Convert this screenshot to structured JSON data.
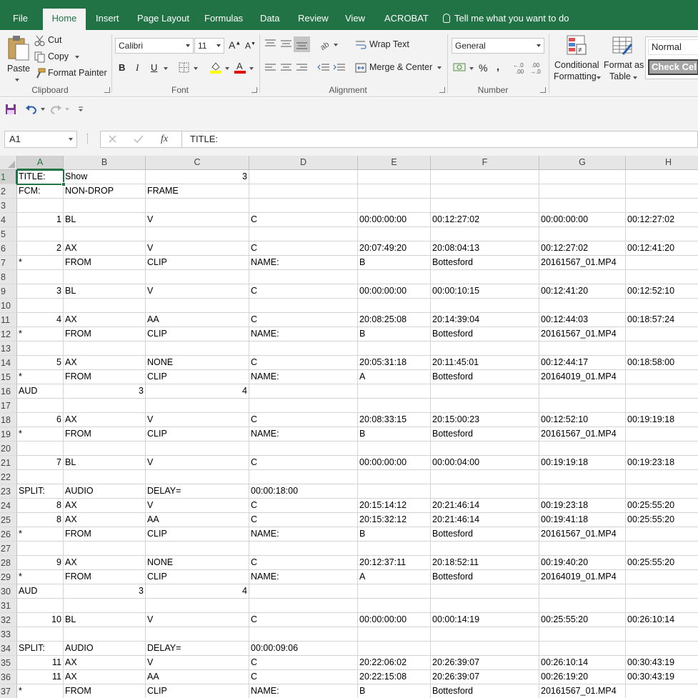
{
  "tabs": [
    "File",
    "Home",
    "Insert",
    "Page Layout",
    "Formulas",
    "Data",
    "Review",
    "View",
    "ACROBAT"
  ],
  "active_tab": "Home",
  "tell_me": "Tell me what you want to do",
  "clipboard": {
    "paste": "Paste",
    "cut": "Cut",
    "copy": "Copy",
    "format_painter": "Format Painter",
    "label": "Clipboard"
  },
  "font": {
    "name": "Calibri",
    "size": "11",
    "bold": "B",
    "italic": "I",
    "underline": "U",
    "label": "Font"
  },
  "alignment": {
    "wrap_text": "Wrap Text",
    "merge_center": "Merge & Center",
    "label": "Alignment"
  },
  "number": {
    "format": "General",
    "percent": "%",
    "comma": ",",
    "label": "Number"
  },
  "styles": {
    "conditional_formatting_1": "Conditional",
    "conditional_formatting_2": "Formatting",
    "format_as_table_1": "Format as",
    "format_as_table_2": "Table",
    "normal": "Normal",
    "check_cell": "Check Cell"
  },
  "formula_bar": {
    "name_box": "A1",
    "fx": "fx",
    "content": "TITLE:"
  },
  "columns": [
    "A",
    "B",
    "C",
    "D",
    "E",
    "F",
    "G",
    "H"
  ],
  "selected_column": "A",
  "selected_row": "1",
  "rows": [
    {
      "n": "1",
      "cells": [
        "TITLE:",
        "Show",
        "3",
        "",
        "",
        "",
        "",
        ""
      ]
    },
    {
      "n": "2",
      "cells": [
        "FCM:",
        "NON-DROP",
        "FRAME",
        "",
        "",
        "",
        "",
        ""
      ]
    },
    {
      "n": "3",
      "cells": [
        "",
        "",
        "",
        "",
        "",
        "",
        "",
        ""
      ]
    },
    {
      "n": "4",
      "cells": [
        "1",
        "BL",
        "V",
        "C",
        "00:00:00:00",
        "00:12:27:02",
        "00:00:00:00",
        "00:12:27:02"
      ]
    },
    {
      "n": "5",
      "cells": [
        "",
        "",
        "",
        "",
        "",
        "",
        "",
        ""
      ]
    },
    {
      "n": "6",
      "cells": [
        "2",
        "AX",
        "V",
        "C",
        "20:07:49:20",
        "20:08:04:13",
        "00:12:27:02",
        "00:12:41:20"
      ]
    },
    {
      "n": "7",
      "cells": [
        "*",
        "FROM",
        "CLIP",
        "NAME:",
        "B",
        "Bottesford",
        "20161567_01.MP4",
        ""
      ]
    },
    {
      "n": "8",
      "cells": [
        "",
        "",
        "",
        "",
        "",
        "",
        "",
        ""
      ]
    },
    {
      "n": "9",
      "cells": [
        "3",
        "BL",
        "V",
        "C",
        "00:00:00:00",
        "00:00:10:15",
        "00:12:41:20",
        "00:12:52:10"
      ]
    },
    {
      "n": "10",
      "cells": [
        "",
        "",
        "",
        "",
        "",
        "",
        "",
        ""
      ]
    },
    {
      "n": "11",
      "cells": [
        "4",
        "AX",
        "AA",
        "C",
        "20:08:25:08",
        "20:14:39:04",
        "00:12:44:03",
        "00:18:57:24"
      ]
    },
    {
      "n": "12",
      "cells": [
        "*",
        "FROM",
        "CLIP",
        "NAME:",
        "B",
        "Bottesford",
        "20161567_01.MP4",
        ""
      ]
    },
    {
      "n": "13",
      "cells": [
        "",
        "",
        "",
        "",
        "",
        "",
        "",
        ""
      ]
    },
    {
      "n": "14",
      "cells": [
        "5",
        "AX",
        "NONE",
        "C",
        "20:05:31:18",
        "20:11:45:01",
        "00:12:44:17",
        "00:18:58:00"
      ]
    },
    {
      "n": "15",
      "cells": [
        "*",
        "FROM",
        "CLIP",
        "NAME:",
        "A",
        "Bottesford",
        "20164019_01.MP4",
        ""
      ]
    },
    {
      "n": "16",
      "cells": [
        "AUD",
        "3",
        "4",
        "",
        "",
        "",
        "",
        ""
      ]
    },
    {
      "n": "17",
      "cells": [
        "",
        "",
        "",
        "",
        "",
        "",
        "",
        ""
      ]
    },
    {
      "n": "18",
      "cells": [
        "6",
        "AX",
        "V",
        "C",
        "20:08:33:15",
        "20:15:00:23",
        "00:12:52:10",
        "00:19:19:18"
      ]
    },
    {
      "n": "19",
      "cells": [
        "*",
        "FROM",
        "CLIP",
        "NAME:",
        "B",
        "Bottesford",
        "20161567_01.MP4",
        ""
      ]
    },
    {
      "n": "20",
      "cells": [
        "",
        "",
        "",
        "",
        "",
        "",
        "",
        ""
      ]
    },
    {
      "n": "21",
      "cells": [
        "7",
        "BL",
        "V",
        "C",
        "00:00:00:00",
        "00:00:04:00",
        "00:19:19:18",
        "00:19:23:18"
      ]
    },
    {
      "n": "22",
      "cells": [
        "",
        "",
        "",
        "",
        "",
        "",
        "",
        ""
      ]
    },
    {
      "n": "23",
      "cells": [
        "SPLIT:",
        "AUDIO",
        "DELAY=",
        "00:00:18:00",
        "",
        "",
        "",
        ""
      ]
    },
    {
      "n": "24",
      "cells": [
        "8",
        "AX",
        "V",
        "C",
        "20:15:14:12",
        "20:21:46:14",
        "00:19:23:18",
        "00:25:55:20"
      ]
    },
    {
      "n": "25",
      "cells": [
        "8",
        "AX",
        "AA",
        "C",
        "20:15:32:12",
        "20:21:46:14",
        "00:19:41:18",
        "00:25:55:20"
      ]
    },
    {
      "n": "26",
      "cells": [
        "*",
        "FROM",
        "CLIP",
        "NAME:",
        "B",
        "Bottesford",
        "20161567_01.MP4",
        ""
      ]
    },
    {
      "n": "27",
      "cells": [
        "",
        "",
        "",
        "",
        "",
        "",
        "",
        ""
      ]
    },
    {
      "n": "28",
      "cells": [
        "9",
        "AX",
        "NONE",
        "C",
        "20:12:37:11",
        "20:18:52:11",
        "00:19:40:20",
        "00:25:55:20"
      ]
    },
    {
      "n": "29",
      "cells": [
        "*",
        "FROM",
        "CLIP",
        "NAME:",
        "A",
        "Bottesford",
        "20164019_01.MP4",
        ""
      ]
    },
    {
      "n": "30",
      "cells": [
        "AUD",
        "3",
        "4",
        "",
        "",
        "",
        "",
        ""
      ]
    },
    {
      "n": "31",
      "cells": [
        "",
        "",
        "",
        "",
        "",
        "",
        "",
        ""
      ]
    },
    {
      "n": "32",
      "cells": [
        "10",
        "BL",
        "V",
        "C",
        "00:00:00:00",
        "00:00:14:19",
        "00:25:55:20",
        "00:26:10:14"
      ]
    },
    {
      "n": "33",
      "cells": [
        "",
        "",
        "",
        "",
        "",
        "",
        "",
        ""
      ]
    },
    {
      "n": "34",
      "cells": [
        "SPLIT:",
        "AUDIO",
        "DELAY=",
        "00:00:09:06",
        "",
        "",
        "",
        ""
      ]
    },
    {
      "n": "35",
      "cells": [
        "11",
        "AX",
        "V",
        "C",
        "20:22:06:02",
        "20:26:39:07",
        "00:26:10:14",
        "00:30:43:19"
      ]
    },
    {
      "n": "36",
      "cells": [
        "11",
        "AX",
        "AA",
        "C",
        "20:22:15:08",
        "20:26:39:07",
        "00:26:19:20",
        "00:30:43:19"
      ]
    },
    {
      "n": "37",
      "cells": [
        "*",
        "FROM",
        "CLIP",
        "NAME:",
        "B",
        "Bottesford",
        "20161567_01.MP4",
        ""
      ]
    }
  ],
  "colors": {
    "accent": "#217346",
    "ribbon_bg": "#f3f3f3",
    "header_bg": "#e6e6e6",
    "gridline": "#d4d4d4"
  }
}
